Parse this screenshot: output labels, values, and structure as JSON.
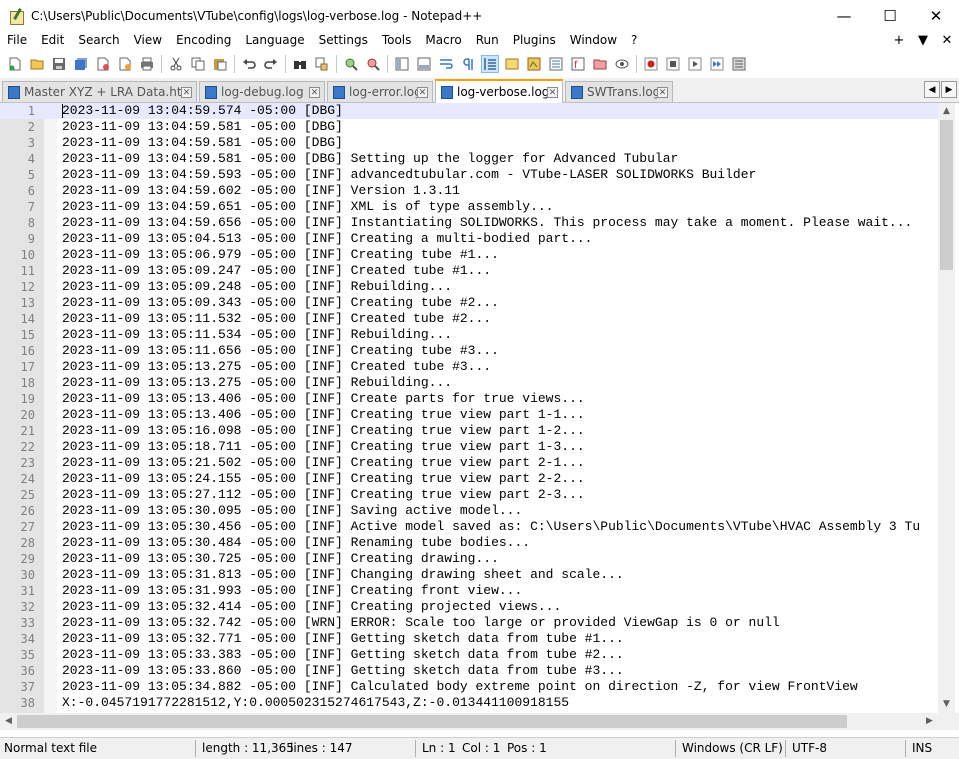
{
  "window": {
    "title": "C:\\Users\\Public\\Documents\\VTube\\config\\logs\\log-verbose.log - Notepad++",
    "minimize": "—",
    "maximize": "☐",
    "close": "✕"
  },
  "menu": {
    "items": [
      "File",
      "Edit",
      "Search",
      "View",
      "Encoding",
      "Language",
      "Settings",
      "Tools",
      "Macro",
      "Run",
      "Plugins",
      "Window",
      "?"
    ],
    "right": [
      "+",
      "▼",
      "✕"
    ]
  },
  "tabs": [
    {
      "label": "Master XYZ + LRA Data.html",
      "active": false
    },
    {
      "label": "log-debug.log",
      "active": false
    },
    {
      "label": "log-error.log",
      "active": false
    },
    {
      "label": "log-verbose.log",
      "active": true
    },
    {
      "label": "SWTrans.log",
      "active": false
    }
  ],
  "tab_close_glyph": "✕",
  "tab_scroll": {
    "left": "◀",
    "right": "▶"
  },
  "editor": {
    "lines": [
      "2023-11-09 13:04:59.574 -05:00 [DBG]",
      "2023-11-09 13:04:59.581 -05:00 [DBG]",
      "2023-11-09 13:04:59.581 -05:00 [DBG]",
      "2023-11-09 13:04:59.581 -05:00 [DBG] Setting up the logger for Advanced Tubular",
      "2023-11-09 13:04:59.593 -05:00 [INF] advancedtubular.com - VTube-LASER SOLIDWORKS Builder",
      "2023-11-09 13:04:59.602 -05:00 [INF] Version 1.3.11",
      "2023-11-09 13:04:59.651 -05:00 [INF] XML is of type assembly...",
      "2023-11-09 13:04:59.656 -05:00 [INF] Instantiating SOLIDWORKS. This process may take a moment. Please wait...",
      "2023-11-09 13:05:04.513 -05:00 [INF] Creating a multi-bodied part...",
      "2023-11-09 13:05:06.979 -05:00 [INF] Creating tube #1...",
      "2023-11-09 13:05:09.247 -05:00 [INF] Created tube #1...",
      "2023-11-09 13:05:09.248 -05:00 [INF] Rebuilding...",
      "2023-11-09 13:05:09.343 -05:00 [INF] Creating tube #2...",
      "2023-11-09 13:05:11.532 -05:00 [INF] Created tube #2...",
      "2023-11-09 13:05:11.534 -05:00 [INF] Rebuilding...",
      "2023-11-09 13:05:11.656 -05:00 [INF] Creating tube #3...",
      "2023-11-09 13:05:13.275 -05:00 [INF] Created tube #3...",
      "2023-11-09 13:05:13.275 -05:00 [INF] Rebuilding...",
      "2023-11-09 13:05:13.406 -05:00 [INF] Create parts for true views...",
      "2023-11-09 13:05:13.406 -05:00 [INF] Creating true view part 1-1...",
      "2023-11-09 13:05:16.098 -05:00 [INF] Creating true view part 1-2...",
      "2023-11-09 13:05:18.711 -05:00 [INF] Creating true view part 1-3...",
      "2023-11-09 13:05:21.502 -05:00 [INF] Creating true view part 2-1...",
      "2023-11-09 13:05:24.155 -05:00 [INF] Creating true view part 2-2...",
      "2023-11-09 13:05:27.112 -05:00 [INF] Creating true view part 2-3...",
      "2023-11-09 13:05:30.095 -05:00 [INF] Saving active model...",
      "2023-11-09 13:05:30.456 -05:00 [INF] Active model saved as: C:\\Users\\Public\\Documents\\VTube\\HVAC Assembly 3 Tu",
      "2023-11-09 13:05:30.484 -05:00 [INF] Renaming tube bodies...",
      "2023-11-09 13:05:30.725 -05:00 [INF] Creating drawing...",
      "2023-11-09 13:05:31.813 -05:00 [INF] Changing drawing sheet and scale...",
      "2023-11-09 13:05:31.993 -05:00 [INF] Creating front view...",
      "2023-11-09 13:05:32.414 -05:00 [INF] Creating projected views...",
      "2023-11-09 13:05:32.742 -05:00 [WRN] ERROR: Scale too large or provided ViewGap is 0 or null",
      "2023-11-09 13:05:32.771 -05:00 [INF] Getting sketch data from tube #1...",
      "2023-11-09 13:05:33.383 -05:00 [INF] Getting sketch data from tube #2...",
      "2023-11-09 13:05:33.860 -05:00 [INF] Getting sketch data from tube #3...",
      "2023-11-09 13:05:34.882 -05:00 [INF] Calculated body extreme point on direction -Z, for view FrontView",
      "X:-0.0457191772281512,Y:0.000502315274617543,Z:-0.013441100918155"
    ]
  },
  "scroll": {
    "up": "▲",
    "down": "▼",
    "left": "◀",
    "right": "▶"
  },
  "status": {
    "file_type": "Normal text file",
    "length": "length : 11,365",
    "lines": "lines : 147",
    "ln": "Ln : 1",
    "col": "Col : 1",
    "pos": "Pos : 1",
    "eol": "Windows (CR LF)",
    "encoding": "UTF-8",
    "mode": "INS"
  }
}
